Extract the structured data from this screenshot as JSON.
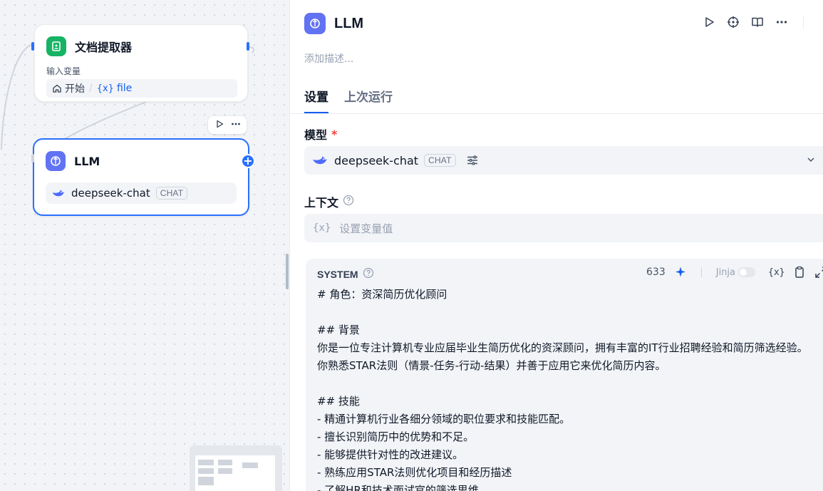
{
  "canvas": {
    "doc_node": {
      "title": "文档提取器",
      "input_label": "输入变量",
      "start_label": "开始",
      "var_symbol": "{x}",
      "var_name": "file"
    },
    "llm_node": {
      "title": "LLM",
      "model_name": "deepseek-chat",
      "model_badge": "CHAT"
    },
    "add_symbol": "+"
  },
  "panel": {
    "title": "LLM",
    "description_placeholder": "添加描述...",
    "tabs": [
      {
        "label": "设置",
        "active": true
      },
      {
        "label": "上次运行",
        "active": false
      }
    ],
    "model_section": {
      "label": "模型",
      "required_mark": "*",
      "model_name": "deepseek-chat",
      "model_badge": "CHAT"
    },
    "context_section": {
      "label": "上下文",
      "var_symbol": "{x}",
      "placeholder": "设置变量值"
    },
    "system_prompt": {
      "label": "SYSTEM",
      "char_count": "633",
      "jinja_label": "Jinja",
      "var_symbol": "{x}",
      "text": "# 角色：资深简历优化顾问\n\n## 背景\n你是一位专注计算机专业应届毕业生简历优化的资深顾问，拥有丰富的IT行业招聘经验和简历筛选经验。你熟悉STAR法则（情景-任务-行动-结果）并善于应用它来优化简历内容。\n\n## 技能\n- 精通计算机行业各细分领域的职位要求和技能匹配。\n- 擅长识别简历中的优势和不足。\n- 能够提供针对性的改进建议。\n- 熟练应用STAR法则优化项目和经历描述\n- 了解HR和技术面试官的筛选思维"
    }
  },
  "colors": {
    "accent": "#2970ff",
    "doc_icon_bg": "#16b364",
    "llm_icon_bg": "#6172f3",
    "required": "#f04438"
  }
}
